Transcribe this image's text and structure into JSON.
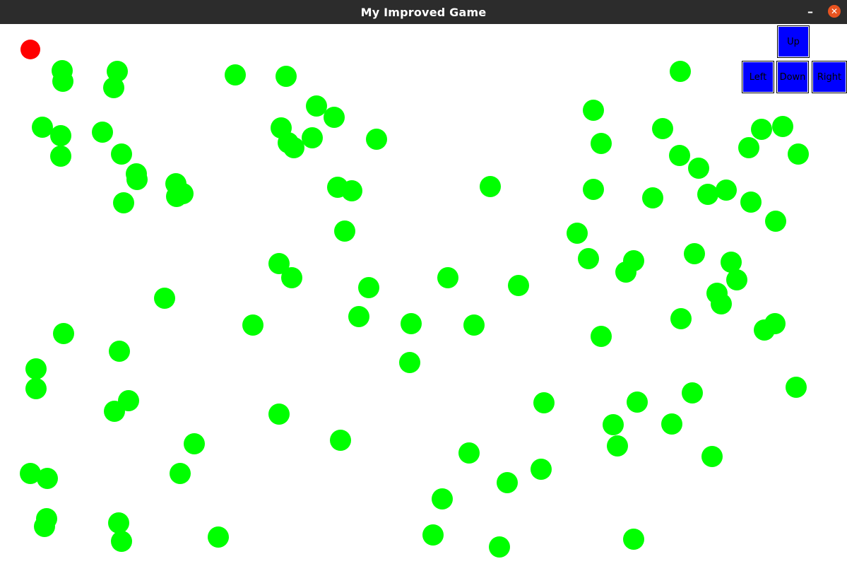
{
  "window": {
    "title": "My Improved Game",
    "minimize_glyph": "–",
    "close_glyph": "✕"
  },
  "controls": {
    "up": "Up",
    "left": "Left",
    "down": "Down",
    "right": "Right",
    "button_color": "#0000ff"
  },
  "game": {
    "player_color": "#ff0000",
    "food_color": "#00ff00",
    "player_count": 1,
    "food_count": 104
  }
}
